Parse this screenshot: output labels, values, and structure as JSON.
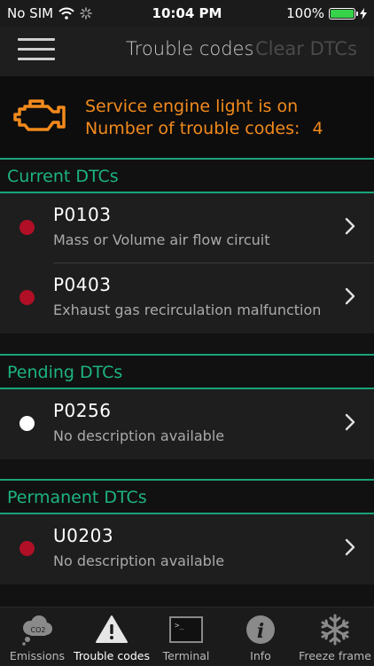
{
  "status_bar": {
    "carrier": "No SIM",
    "time": "10:04 PM",
    "battery": "100%"
  },
  "nav": {
    "title": "Trouble codes",
    "clear_label": "Clear DTCs"
  },
  "banner": {
    "line1": "Service engine light is on",
    "line2_label": "Number of trouble codes:",
    "count": "4"
  },
  "colors": {
    "accent": "#1db383",
    "warning": "#f28a1c",
    "dtc_current": "#b00f25",
    "dtc_pending": "#ffffff"
  },
  "sections": {
    "current": {
      "header": "Current DTCs",
      "items": [
        {
          "code": "P0103",
          "description": "Mass or Volume air flow circuit"
        },
        {
          "code": "P0403",
          "description": "Exhaust gas recirculation malfunction"
        }
      ]
    },
    "pending": {
      "header": "Pending DTCs",
      "items": [
        {
          "code": "P0256",
          "description": "No description available"
        }
      ]
    },
    "permanent": {
      "header": "Permanent DTCs",
      "items": [
        {
          "code": "U0203",
          "description": "No description available"
        }
      ]
    }
  },
  "tabs": [
    {
      "label": "Emissions",
      "icon": "cloud-co2-icon",
      "icon_text": "CO2"
    },
    {
      "label": "Trouble codes",
      "icon": "warning-triangle-icon"
    },
    {
      "label": "Terminal",
      "icon": "terminal-icon",
      "icon_text": ">_"
    },
    {
      "label": "Info",
      "icon": "info-icon",
      "icon_text": "i"
    },
    {
      "label": "Freeze frame",
      "icon": "snowflake-icon"
    }
  ],
  "active_tab": "Trouble codes"
}
